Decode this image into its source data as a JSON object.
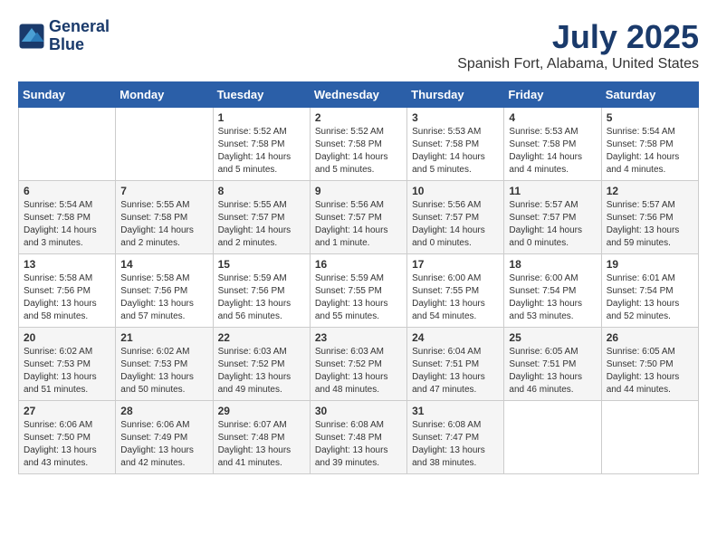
{
  "header": {
    "logo_line1": "General",
    "logo_line2": "Blue",
    "title": "July 2025",
    "subtitle": "Spanish Fort, Alabama, United States"
  },
  "calendar": {
    "weekdays": [
      "Sunday",
      "Monday",
      "Tuesday",
      "Wednesday",
      "Thursday",
      "Friday",
      "Saturday"
    ],
    "weeks": [
      [
        {
          "day": "",
          "info": ""
        },
        {
          "day": "",
          "info": ""
        },
        {
          "day": "1",
          "info": "Sunrise: 5:52 AM\nSunset: 7:58 PM\nDaylight: 14 hours\nand 5 minutes."
        },
        {
          "day": "2",
          "info": "Sunrise: 5:52 AM\nSunset: 7:58 PM\nDaylight: 14 hours\nand 5 minutes."
        },
        {
          "day": "3",
          "info": "Sunrise: 5:53 AM\nSunset: 7:58 PM\nDaylight: 14 hours\nand 5 minutes."
        },
        {
          "day": "4",
          "info": "Sunrise: 5:53 AM\nSunset: 7:58 PM\nDaylight: 14 hours\nand 4 minutes."
        },
        {
          "day": "5",
          "info": "Sunrise: 5:54 AM\nSunset: 7:58 PM\nDaylight: 14 hours\nand 4 minutes."
        }
      ],
      [
        {
          "day": "6",
          "info": "Sunrise: 5:54 AM\nSunset: 7:58 PM\nDaylight: 14 hours\nand 3 minutes."
        },
        {
          "day": "7",
          "info": "Sunrise: 5:55 AM\nSunset: 7:58 PM\nDaylight: 14 hours\nand 2 minutes."
        },
        {
          "day": "8",
          "info": "Sunrise: 5:55 AM\nSunset: 7:57 PM\nDaylight: 14 hours\nand 2 minutes."
        },
        {
          "day": "9",
          "info": "Sunrise: 5:56 AM\nSunset: 7:57 PM\nDaylight: 14 hours\nand 1 minute."
        },
        {
          "day": "10",
          "info": "Sunrise: 5:56 AM\nSunset: 7:57 PM\nDaylight: 14 hours\nand 0 minutes."
        },
        {
          "day": "11",
          "info": "Sunrise: 5:57 AM\nSunset: 7:57 PM\nDaylight: 14 hours\nand 0 minutes."
        },
        {
          "day": "12",
          "info": "Sunrise: 5:57 AM\nSunset: 7:56 PM\nDaylight: 13 hours\nand 59 minutes."
        }
      ],
      [
        {
          "day": "13",
          "info": "Sunrise: 5:58 AM\nSunset: 7:56 PM\nDaylight: 13 hours\nand 58 minutes."
        },
        {
          "day": "14",
          "info": "Sunrise: 5:58 AM\nSunset: 7:56 PM\nDaylight: 13 hours\nand 57 minutes."
        },
        {
          "day": "15",
          "info": "Sunrise: 5:59 AM\nSunset: 7:56 PM\nDaylight: 13 hours\nand 56 minutes."
        },
        {
          "day": "16",
          "info": "Sunrise: 5:59 AM\nSunset: 7:55 PM\nDaylight: 13 hours\nand 55 minutes."
        },
        {
          "day": "17",
          "info": "Sunrise: 6:00 AM\nSunset: 7:55 PM\nDaylight: 13 hours\nand 54 minutes."
        },
        {
          "day": "18",
          "info": "Sunrise: 6:00 AM\nSunset: 7:54 PM\nDaylight: 13 hours\nand 53 minutes."
        },
        {
          "day": "19",
          "info": "Sunrise: 6:01 AM\nSunset: 7:54 PM\nDaylight: 13 hours\nand 52 minutes."
        }
      ],
      [
        {
          "day": "20",
          "info": "Sunrise: 6:02 AM\nSunset: 7:53 PM\nDaylight: 13 hours\nand 51 minutes."
        },
        {
          "day": "21",
          "info": "Sunrise: 6:02 AM\nSunset: 7:53 PM\nDaylight: 13 hours\nand 50 minutes."
        },
        {
          "day": "22",
          "info": "Sunrise: 6:03 AM\nSunset: 7:52 PM\nDaylight: 13 hours\nand 49 minutes."
        },
        {
          "day": "23",
          "info": "Sunrise: 6:03 AM\nSunset: 7:52 PM\nDaylight: 13 hours\nand 48 minutes."
        },
        {
          "day": "24",
          "info": "Sunrise: 6:04 AM\nSunset: 7:51 PM\nDaylight: 13 hours\nand 47 minutes."
        },
        {
          "day": "25",
          "info": "Sunrise: 6:05 AM\nSunset: 7:51 PM\nDaylight: 13 hours\nand 46 minutes."
        },
        {
          "day": "26",
          "info": "Sunrise: 6:05 AM\nSunset: 7:50 PM\nDaylight: 13 hours\nand 44 minutes."
        }
      ],
      [
        {
          "day": "27",
          "info": "Sunrise: 6:06 AM\nSunset: 7:50 PM\nDaylight: 13 hours\nand 43 minutes."
        },
        {
          "day": "28",
          "info": "Sunrise: 6:06 AM\nSunset: 7:49 PM\nDaylight: 13 hours\nand 42 minutes."
        },
        {
          "day": "29",
          "info": "Sunrise: 6:07 AM\nSunset: 7:48 PM\nDaylight: 13 hours\nand 41 minutes."
        },
        {
          "day": "30",
          "info": "Sunrise: 6:08 AM\nSunset: 7:48 PM\nDaylight: 13 hours\nand 39 minutes."
        },
        {
          "day": "31",
          "info": "Sunrise: 6:08 AM\nSunset: 7:47 PM\nDaylight: 13 hours\nand 38 minutes."
        },
        {
          "day": "",
          "info": ""
        },
        {
          "day": "",
          "info": ""
        }
      ]
    ]
  }
}
